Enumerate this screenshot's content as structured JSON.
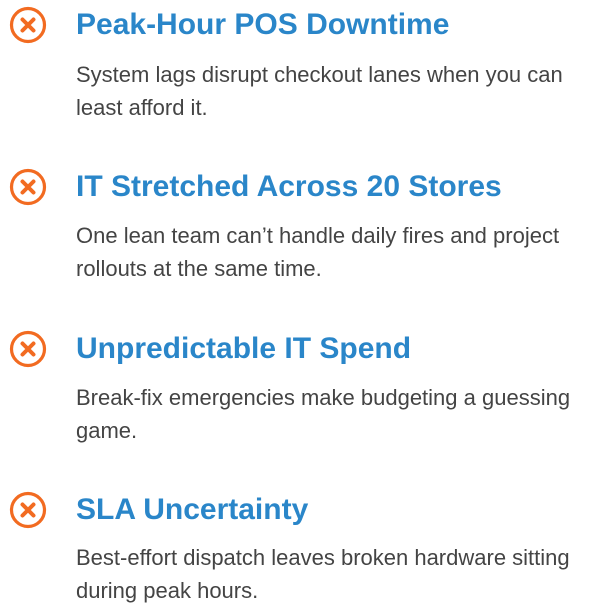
{
  "colors": {
    "icon": "#f26b21",
    "title": "#2a86c9",
    "text": "#444444"
  },
  "items": [
    {
      "icon": "x-circle-icon",
      "title": "Peak-Hour POS Downtime",
      "description": "System lags disrupt checkout lanes when you can least afford it."
    },
    {
      "icon": "x-circle-icon",
      "title": "IT Stretched Across 20 Stores",
      "description": "One lean team can’t handle daily fires and project rollouts at the same time."
    },
    {
      "icon": "x-circle-icon",
      "title": "Unpredictable IT Spend",
      "description": "Break-fix emergencies make budgeting a guessing game."
    },
    {
      "icon": "x-circle-icon",
      "title": "SLA Uncertainty",
      "description": "Best-effort dispatch leaves broken hardware sitting during peak hours."
    }
  ]
}
